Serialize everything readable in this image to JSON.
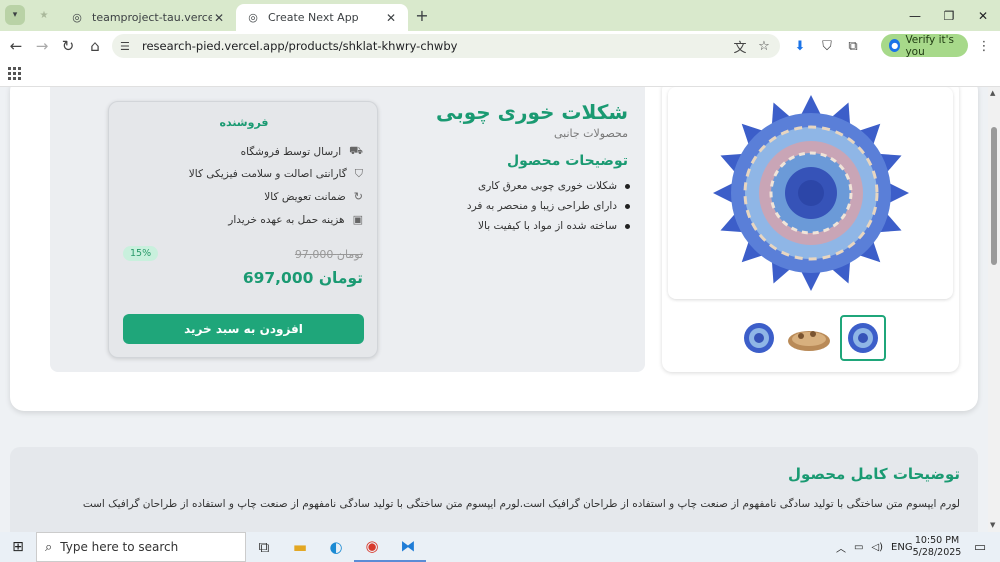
{
  "browser": {
    "tabs": [
      {
        "title": "teamproject-tau.vercel.app/pro",
        "active": false
      },
      {
        "title": "Create Next App",
        "active": true
      }
    ],
    "url": "research-pied.vercel.app/products/shklat-khwry-chwby",
    "verify_label": "Verify it's you"
  },
  "product": {
    "title": "شکلات خوری چوبی",
    "category": "محصولات جانبی",
    "desc_title": "توضیحات محصول",
    "bullets": [
      "شکلات خوری چوبی معرق کاری",
      "دارای طراحی زیبا و منحصر به فرد",
      "ساخته شده از مواد با کیفیت بالا"
    ]
  },
  "seller": {
    "title": "فروشنده",
    "features": [
      "ارسال توسط فروشگاه",
      "گارانتی اصالت و سلامت فیزیکی کالا",
      "ضمانت تعویض کالا",
      "هزینه حمل به عهده خریدار"
    ],
    "discount": "15%",
    "old_price": "97,000 تومان",
    "new_price": "697,000 تومان",
    "cart_label": "افزودن به سبد خرید"
  },
  "full_desc": {
    "title": "توضیحات کامل محصول",
    "text": "لورم ایپسوم متن ساختگی با تولید سادگی نامفهوم از صنعت چاپ و استفاده از طراحان گرافیک است.لورم ایپسوم متن ساختگی با تولید سادگی نامفهوم از صنعت چاپ و استفاده از طراحان گرافیک است"
  },
  "taskbar": {
    "search_placeholder": "Type here to search",
    "lang": "ENG",
    "time": "10:50 PM",
    "date": "5/28/2025"
  },
  "colors": {
    "accent": "#1fa67a",
    "title_green": "#1a9a72",
    "tab_bar": "#d9e9cc"
  }
}
